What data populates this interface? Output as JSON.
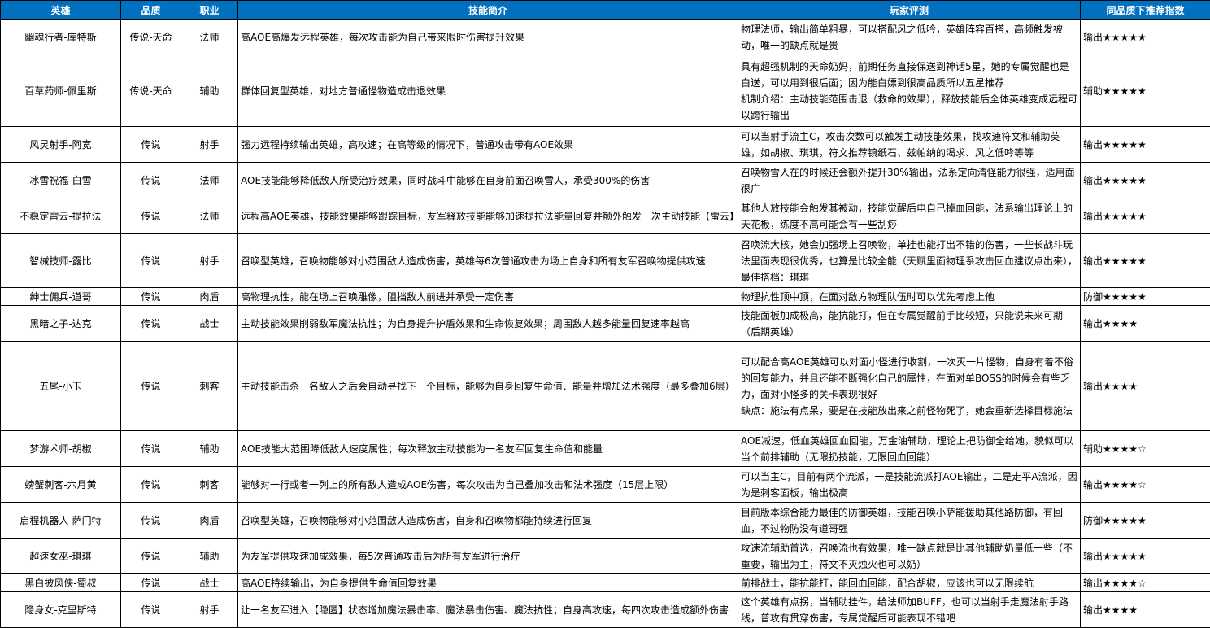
{
  "headers": [
    "英雄",
    "品质",
    "职业",
    "技能简介",
    "玩家评测",
    "同品质下推荐指数"
  ],
  "rows": [
    {
      "hero": "幽魂行者-库特斯",
      "quality": "传说-天命",
      "role": "法师",
      "skill": "高AOE高爆发远程英雄，每次攻击能为自己带来限时伤害提升效果",
      "review": [
        "物理法师，输出简单粗暴，可以搭配风之低吟，英雄阵容百搭，高频触发被动，唯一的缺点就是贵"
      ],
      "rating": "输出★★★★★"
    },
    {
      "hero": "百草药师-佩里斯",
      "quality": "传说-天命",
      "role": "辅助",
      "skill": "群体回复型英雄，对地方普通怪物造成击退效果",
      "review": [
        "具有超强机制的天命奶妈，前期任务直接保送到神话5星，她的专属觉醒也是白送，可以用到很后面；因为能白嫖到很高品质所以五星推荐",
        "机制介绍：主动技能范围击退（救命的效果），释放技能后全体英雄变成远程可以跨行输出"
      ],
      "rating": "辅助★★★★★"
    },
    {
      "hero": "风灵射手-阿宽",
      "quality": "传说",
      "role": "射手",
      "skill": "强力远程持续输出英雄，高攻速；在高等级的情况下，普通攻击带有AOE效果",
      "review": [
        "可以当射手流主C，攻击次数可以触发主动技能效果，找攻速符文和辅助英雄，如胡椒、琪琪，符文推荐镇纸石、兹帕纳的渴求、风之低吟等等"
      ],
      "rating": "输出★★★★★"
    },
    {
      "hero": "冰雪祝福-白雪",
      "quality": "传说",
      "role": "法师",
      "skill": "AOE技能能够降低敌人所受治疗效果，同时战斗中能够在自身前面召唤雪人，承受300%的伤害",
      "review": [
        "召唤物雪人在的时候还会额外提升30%输出，法系定向清怪能力很强，适用面很广"
      ],
      "rating": "输出★★★★★"
    },
    {
      "hero": "不稳定雷云-提拉法",
      "quality": "传说",
      "role": "法师",
      "skill": "远程高AOE英雄，技能效果能够跟踪目标，友军释放技能能够加速提拉法能量回复并额外触发一次主动技能【雷云】",
      "review": [
        "其他人放技能会触发其被动，技能觉醒后电自己掉血回能，法系输出理论上的天花板，练度不高可能会有一些刮痧"
      ],
      "rating": "输出★★★★★"
    },
    {
      "hero": "智械技师-露比",
      "quality": "传说",
      "role": "射手",
      "skill": "召唤型英雄，召唤物能够对小范围敌人造成伤害，英雄每6次普通攻击为场上自身和所有友军召唤物提供攻速",
      "review": [
        "召唤流大核，她会加强场上召唤物，单挂也能打出不错的伤害，一些长战斗玩法里面表现很优秀，也算是比较全能（天赋里面物理系攻击回血建议点出来），最佳搭档：琪琪"
      ],
      "rating": "输出★★★★★"
    },
    {
      "hero": "绅士佣兵-道哥",
      "quality": "传说",
      "role": "肉盾",
      "skill": "高物理抗性，能在场上召唤雕像，阻挡敌人前进并承受一定伤害",
      "review": [
        "物理抗性顶中顶，在面对敌方物理队伍时可以优先考虑上他"
      ],
      "rating": "防御★★★★★"
    },
    {
      "hero": "黑暗之子-达克",
      "quality": "传说",
      "role": "战士",
      "skill": "主动技能效果削弱敌军魔法抗性；为自身提升护盾效果和生命恢复效果；周围敌人越多能量回复速率越高",
      "review": [
        "技能面板加成极高，能抗能打，但在专属觉醒前手比较短，只能说未来可期（后期英雄）"
      ],
      "rating": "输出★★★★"
    },
    {
      "hero": "五尾-小玉",
      "quality": "传说",
      "role": "刺客",
      "skill": "主动技能击杀一名敌人之后会自动寻找下一个目标，能够为自身回复生命值、能量并增加法术强度（最多叠加6层）",
      "review": [
        "可以配合高AOE英雄可以对面小怪进行收割，一次灭一片怪物，自身有着不俗的回复能力，并且还能不断强化自己的属性，在面对单BOSS的时候会有些乏力，面对小怪多的关卡表现很好",
        "缺点：施法有点呆，要是在技能放出来之前怪物死了，她会重新选择目标施法"
      ],
      "rating": "输出★★★★"
    },
    {
      "hero": "梦游术师-胡椒",
      "quality": "传说",
      "role": "辅助",
      "skill": "AOE技能大范围降低敌人速度属性；每次释放主动技能为一名友军回复生命值和能量",
      "review": [
        "AOE减速，低血英雄回血回能，万金油辅助，理论上把防御全给她，貌似可以当个前排辅助（无限扔技能，无限回血回能）"
      ],
      "rating": "辅助★★★★☆"
    },
    {
      "hero": "螃蟹刺客-六月黄",
      "quality": "传说",
      "role": "刺客",
      "skill": "能够对一行或者一列上的所有敌人造成AOE伤害，每次攻击为自己叠加攻击和法术强度（15层上限）",
      "review": [
        "可以当主C，目前有两个流派，一是技能流派打AOE输出，二是走平A流派，因为是刺客面板，输出极高"
      ],
      "rating": "输出★★★★☆"
    },
    {
      "hero": "启程机器人-萨门特",
      "quality": "传说",
      "role": "肉盾",
      "skill": "召唤型英雄，召唤物能够对小范围敌人造成伤害，自身和召唤物都能持续进行回复",
      "review": [
        "目前版本综合能力最佳的防御英雄，技能召唤小萨能援助其他路防御，有回血，不过物防没有道哥强"
      ],
      "rating": "防御★★★★★"
    },
    {
      "hero": "超速女巫-琪琪",
      "quality": "传说",
      "role": "辅助",
      "skill": "为友军提供攻速加成效果，每5次普通攻击后为所有友军进行治疗",
      "review": [
        "攻速流辅助首选，召唤流也有效果，唯一缺点就是比其他辅助奶量低一些（不重要，输出为主，符文不灭烛火也可以奶）"
      ],
      "rating": "输出★★★★★"
    },
    {
      "hero": "黑白披风侠-蜀叔",
      "quality": "传说",
      "role": "战士",
      "skill": "高AOE持续输出，为自身提供生命值回复效果",
      "review": [
        "前排战士，能抗能打，能回血回能，配合胡椒，应该也可以无限续航"
      ],
      "rating": "输出★★★★☆"
    },
    {
      "hero": "隐身女-克里斯特",
      "quality": "传说",
      "role": "射手",
      "skill": "让一名友军进入【隐匿】状态增加魔法暴击率、魔法暴击伤害、魔法抗性；自身高攻速，每四次攻击造成额外伤害",
      "review": [
        "这个英雄有点拐，当辅助挂件，给法师加BUFF，也可以当射手走魔法射手路线，普攻有贯穿伤害，专属觉醒后可能表现不错吧"
      ],
      "rating": "输出★★★★"
    }
  ]
}
